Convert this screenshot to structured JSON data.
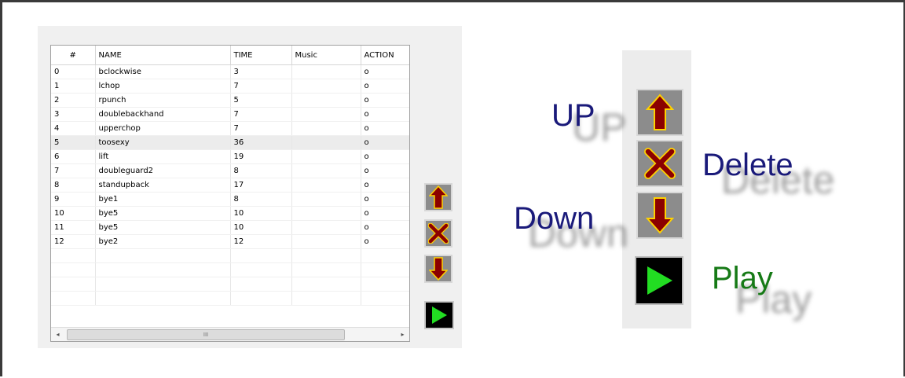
{
  "table": {
    "columns": [
      "#",
      "NAME",
      "TIME",
      "Music",
      "ACTION"
    ],
    "rows": [
      {
        "num": "0",
        "name": "bclockwise",
        "time": "3",
        "music": "",
        "action": "o"
      },
      {
        "num": "1",
        "name": "lchop",
        "time": "7",
        "music": "",
        "action": "o"
      },
      {
        "num": "2",
        "name": "rpunch",
        "time": "5",
        "music": "",
        "action": "o"
      },
      {
        "num": "3",
        "name": "doublebackhand",
        "time": "7",
        "music": "",
        "action": "o"
      },
      {
        "num": "4",
        "name": "upperchop",
        "time": "7",
        "music": "",
        "action": "o"
      },
      {
        "num": "5",
        "name": "toosexy",
        "time": "36",
        "music": "",
        "action": "o",
        "selected": true
      },
      {
        "num": "6",
        "name": "lift",
        "time": "19",
        "music": "",
        "action": "o"
      },
      {
        "num": "7",
        "name": "doubleguard2",
        "time": "8",
        "music": "",
        "action": "o"
      },
      {
        "num": "8",
        "name": "standupback",
        "time": "17",
        "music": "",
        "action": "o"
      },
      {
        "num": "9",
        "name": "bye1",
        "time": "8",
        "music": "",
        "action": "o"
      },
      {
        "num": "10",
        "name": "bye5",
        "time": "10",
        "music": "",
        "action": "o"
      },
      {
        "num": "11",
        "name": "bye5",
        "time": "10",
        "music": "",
        "action": "o"
      },
      {
        "num": "12",
        "name": "bye2",
        "time": "12",
        "music": "",
        "action": "o"
      }
    ],
    "scroll_thumb_label": "III",
    "scroll_left": "◂",
    "scroll_right": "▸"
  },
  "controls": {
    "up_icon": "up-arrow-icon",
    "delete_icon": "x-delete-icon",
    "down_icon": "down-arrow-icon",
    "play_icon": "play-icon"
  },
  "legend": {
    "up": "UP",
    "delete": "Delete",
    "down": "Down",
    "play": "Play"
  },
  "colors": {
    "arrow_fill": "#8b0000",
    "arrow_outline": "#ffd200",
    "play_fill": "#22dd22",
    "legend_blue": "#1a1a7a",
    "legend_green": "#167a16"
  }
}
